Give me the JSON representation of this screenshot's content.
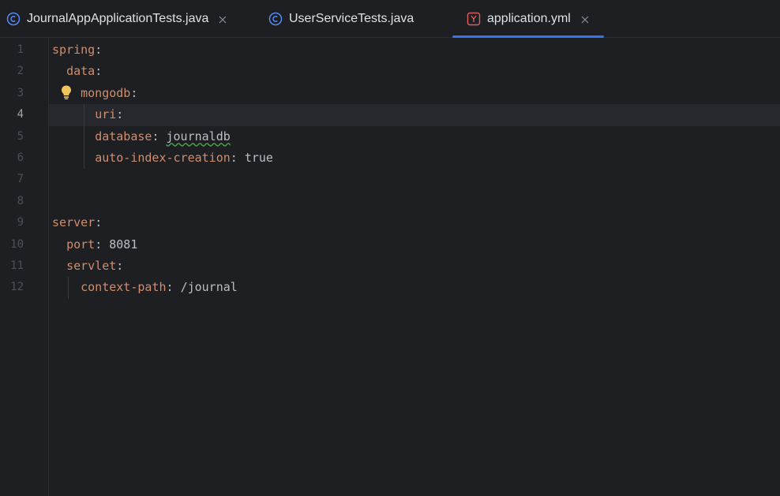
{
  "tabs": [
    {
      "label": "JournalAppApplicationTests.java",
      "icon": "java-class-icon",
      "closable": true,
      "active": false
    },
    {
      "label": "UserServiceTests.java",
      "icon": "java-class-icon",
      "closable": false,
      "active": false
    },
    {
      "label": "application.yml",
      "icon": "yaml-file-icon",
      "closable": true,
      "active": true
    }
  ],
  "editor": {
    "current_line": 4,
    "line_numbers": [
      "1",
      "2",
      "3",
      "4",
      "5",
      "6",
      "7",
      "8",
      "9",
      "10",
      "11",
      "12"
    ],
    "lines": [
      {
        "indent": "",
        "key": "spring",
        "colon": ":",
        "value": ""
      },
      {
        "indent": "  ",
        "key": "data",
        "colon": ":",
        "value": ""
      },
      {
        "indent": "    ",
        "key": "mongodb",
        "colon": ":",
        "value": ""
      },
      {
        "indent": "      ",
        "key": "uri",
        "colon": ":",
        "value": ""
      },
      {
        "indent": "      ",
        "key": "database",
        "colon": ": ",
        "value": "journaldb"
      },
      {
        "indent": "      ",
        "key": "auto-index-creation",
        "colon": ": ",
        "value": "true"
      },
      {
        "indent": "",
        "key": "",
        "colon": "",
        "value": ""
      },
      {
        "indent": "",
        "key": "",
        "colon": "",
        "value": ""
      },
      {
        "indent": "",
        "key": "server",
        "colon": ":",
        "value": ""
      },
      {
        "indent": "  ",
        "key": "port",
        "colon": ": ",
        "value": "8081"
      },
      {
        "indent": "  ",
        "key": "servlet",
        "colon": ":",
        "value": ""
      },
      {
        "indent": "    ",
        "key": "context-path",
        "colon": ": ",
        "value": "/journal"
      }
    ]
  },
  "colors": {
    "background": "#1e1f22",
    "key": "#cf8e6d",
    "text": "#bcbec4",
    "line_number": "#4b5059",
    "active_tab_underline": "#3574f0",
    "java_icon": "#548af7",
    "yaml_icon": "#db5c5c",
    "bulb": "#f2c55c"
  }
}
